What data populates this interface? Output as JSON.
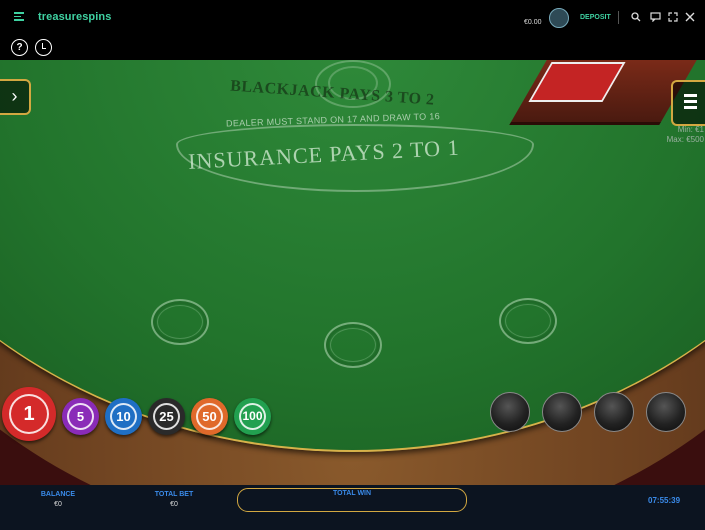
{
  "header": {
    "brand_left": "treasure",
    "brand_right": "spins",
    "balance": "€0.00",
    "deposit_label": "DEPOSIT",
    "icons": [
      "menu-icon",
      "wallet-icon",
      "search-icon",
      "chat-icon",
      "fullscreen-icon",
      "close-icon"
    ]
  },
  "toolbar": {
    "help_label": "?",
    "icons": [
      "help-icon",
      "history-icon"
    ]
  },
  "table": {
    "payout_text": "BLACKJACK PAYS 3 TO 2",
    "dealer_rule": "DEALER MUST STAND ON 17 AND DRAW TO 16",
    "insurance_text": "INSURANCE PAYS 2 TO 1",
    "bet_spots": 3,
    "limits": {
      "min": "Min: €1",
      "max": "Max: €500"
    },
    "left_toggle": "›"
  },
  "chips": [
    {
      "value": "1",
      "color": "#d42a2a"
    },
    {
      "value": "5",
      "color": "#8a2bb8"
    },
    {
      "value": "10",
      "color": "#1f6fc4"
    },
    {
      "value": "25",
      "color": "#2a2a2a"
    },
    {
      "value": "50",
      "color": "#e0692a"
    },
    {
      "value": "100",
      "color": "#22a050"
    }
  ],
  "action_slots": 4,
  "footer": {
    "balance_label": "BALANCE",
    "balance_value": "€0",
    "total_bet_label": "TOTAL BET",
    "total_bet_value": "€0",
    "total_win_label": "TOTAL WIN",
    "time": "07:55:39"
  },
  "colors": {
    "accent": "#3fd2a2",
    "gold": "#d3a841",
    "felt": "#22742c",
    "footer_label": "#3a8bea"
  }
}
